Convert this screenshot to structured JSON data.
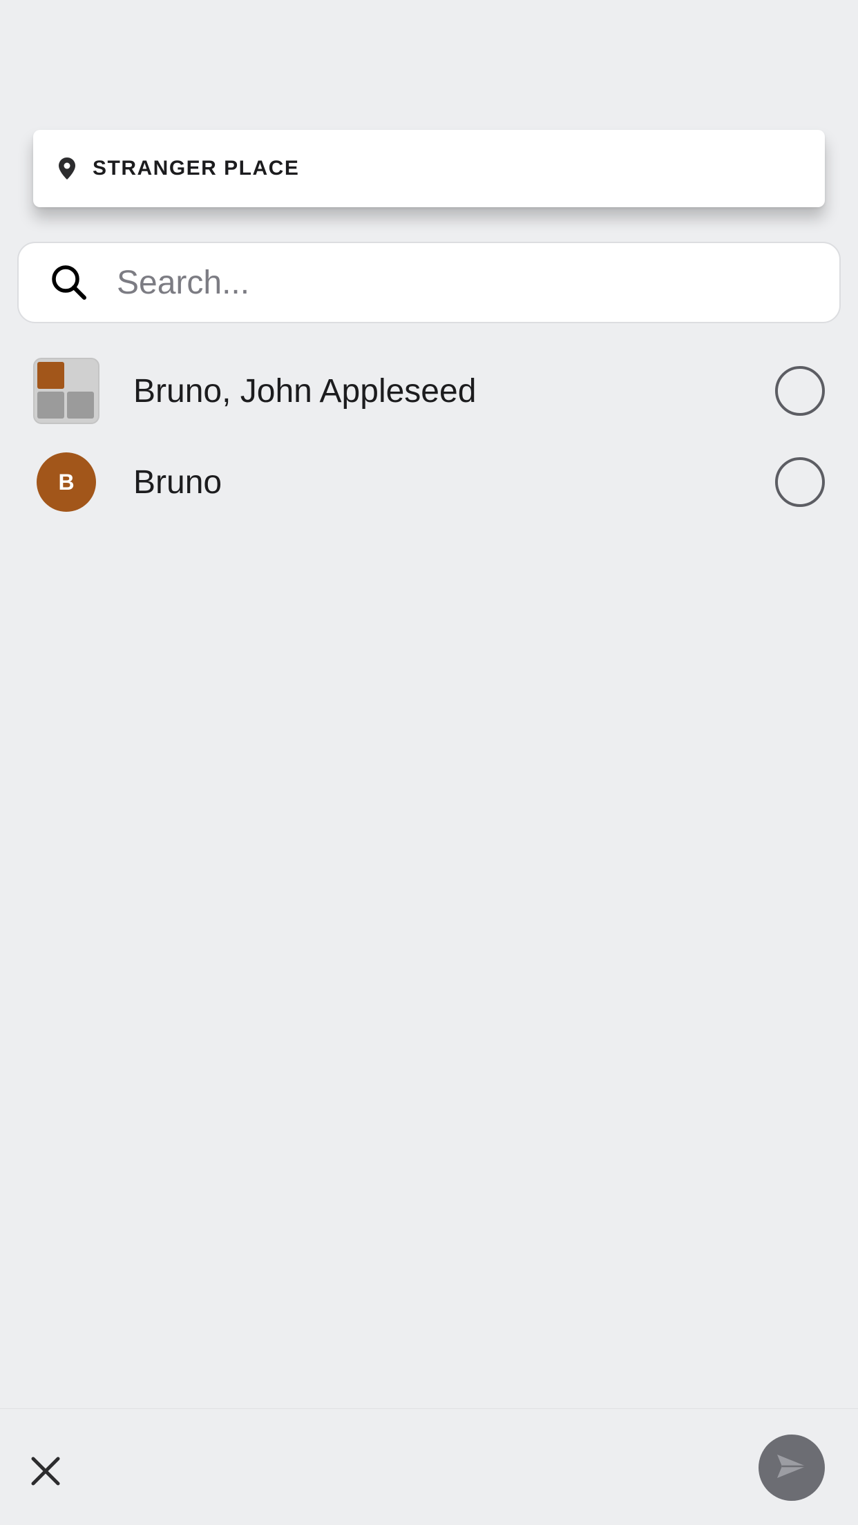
{
  "location": {
    "label": "STRANGER PLACE",
    "icon": "map-pin-icon"
  },
  "search": {
    "placeholder": "Search...",
    "value": "",
    "icon": "search-icon"
  },
  "contacts": [
    {
      "label": "Bruno, John Appleseed",
      "avatar": "group-avatar",
      "selected": false
    },
    {
      "label": "Bruno",
      "avatar_initial": "B",
      "selected": false
    }
  ],
  "colors": {
    "background": "#edeef0",
    "avatar_accent": "#a2561a",
    "send_button": "#6c6d73"
  },
  "bottom_bar": {
    "close_icon": "close-icon",
    "send_icon": "send-icon"
  }
}
